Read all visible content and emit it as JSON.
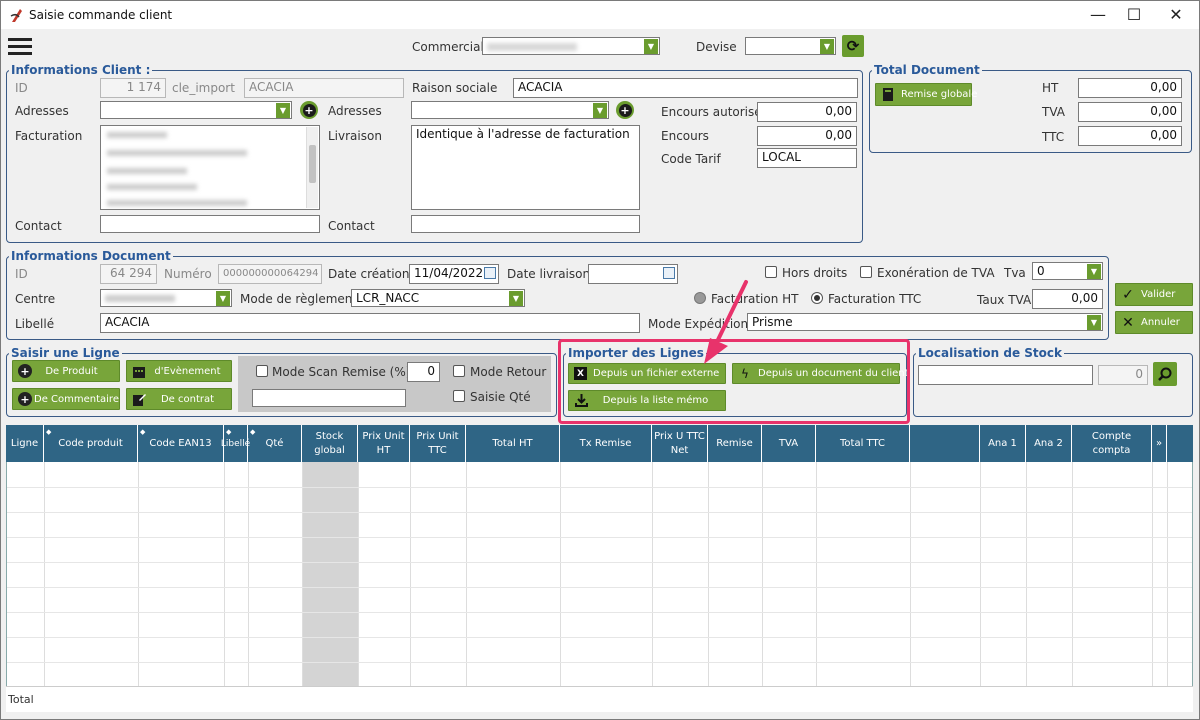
{
  "window": {
    "title": "Saisie commande client",
    "minimize": "—",
    "maximize": "☐",
    "close": "✕"
  },
  "top": {
    "commercial_label": "Commercial",
    "commercial_value": "",
    "devise_label": "Devise",
    "devise_value": ""
  },
  "client": {
    "legend": "Informations Client :",
    "id_label": "ID",
    "id_value": "1 174",
    "cle_label": "cle_import",
    "cle_value": "ACACIA",
    "raison_label": "Raison sociale",
    "raison_value": "ACACIA",
    "adresses_label": "Adresses",
    "adresses2_label": "Adresses",
    "facturation_label": "Facturation",
    "livraison_label": "Livraison",
    "livraison_value": "Identique à l'adresse de facturation",
    "encours_autorise_label": "Encours autorisé",
    "encours_autorise_value": "0,00",
    "encours_label": "Encours",
    "encours_value": "0,00",
    "code_tarif_label": "Code Tarif",
    "code_tarif_value": "LOCAL",
    "contact_label": "Contact",
    "contact2_label": "Contact"
  },
  "total": {
    "legend": "Total Document",
    "remise_button": "Remise globale",
    "ht_label": "HT",
    "ht_value": "0,00",
    "tva_label": "TVA",
    "tva_value": "0,00",
    "ttc_label": "TTC",
    "ttc_value": "0,00"
  },
  "doc": {
    "legend": "Informations Document",
    "id_label": "ID",
    "id_value": "64 294",
    "numero_label": "Numéro",
    "numero_value": "000000000064294",
    "date_creation_label": "Date création",
    "date_creation_value": "11/04/2022",
    "date_livraison_label": "Date livraison",
    "date_livraison_value": "",
    "hors_droits_label": "Hors droits",
    "exoneration_label": "Exonération de TVA",
    "tva_label": "Tva",
    "tva_value": "0",
    "centre_label": "Centre",
    "mode_reglement_label": "Mode de règlement",
    "mode_reglement_value": "LCR_NACC",
    "facturation_ht_label": "Facturation HT",
    "facturation_ttc_label": "Facturation TTC",
    "taux_tva_label": "Taux TVA",
    "taux_tva_value": "0,00",
    "libelle_label": "Libellé",
    "libelle_value": "ACACIA",
    "mode_expedition_label": "Mode Expédition",
    "mode_expedition_value": "Prisme"
  },
  "actions": {
    "valider": "Valider",
    "annuler": "Annuler"
  },
  "saisir": {
    "legend": "Saisir une Ligne",
    "de_produit": "De Produit",
    "d_evenement": "d'Evènement",
    "de_commentaire": "De Commentaire",
    "de_contrat": "De contrat",
    "mode_scan": "Mode Scan",
    "remise_label": "Remise (%)",
    "remise_value": "0",
    "mode_retour": "Mode Retour",
    "saisie_qte": "Saisie Qté"
  },
  "importer": {
    "legend": "Importer des Lignes",
    "fichier_externe": "Depuis un fichier externe",
    "document_client": "Depuis un document du client",
    "liste_memo": "Depuis la liste mémo"
  },
  "stock": {
    "legend": "Localisation de Stock",
    "qty_value": "0"
  },
  "table": {
    "columns": [
      {
        "label": "Ligne",
        "sort": false
      },
      {
        "label": "Code produit",
        "sort": true
      },
      {
        "label": "Code EAN13",
        "sort": true
      },
      {
        "label": "Libellé",
        "sort": true
      },
      {
        "label": "Qté",
        "sort": true
      },
      {
        "label": "Stock global",
        "sort": false
      },
      {
        "label": "Prix Unit HT",
        "sort": false
      },
      {
        "label": "Prix Unit TTC",
        "sort": false
      },
      {
        "label": "Total HT",
        "sort": false
      },
      {
        "label": "Tx Remise",
        "sort": false
      },
      {
        "label": "Prix U TTC Net",
        "sort": false
      },
      {
        "label": "Remise",
        "sort": false
      },
      {
        "label": "TVA",
        "sort": false
      },
      {
        "label": "Total TTC",
        "sort": false
      },
      {
        "label": "",
        "sort": false
      },
      {
        "label": "Ana 1",
        "sort": false
      },
      {
        "label": "Ana 2",
        "sort": false
      },
      {
        "label": "Compte compta",
        "sort": false
      },
      {
        "label": "»",
        "sort": false
      }
    ],
    "total_label": "Total"
  },
  "colors": {
    "accent_green": "#78a53a",
    "header_blue": "#2f6585",
    "legend_blue": "#2a5a9a",
    "highlight_pink": "#e8336b"
  }
}
